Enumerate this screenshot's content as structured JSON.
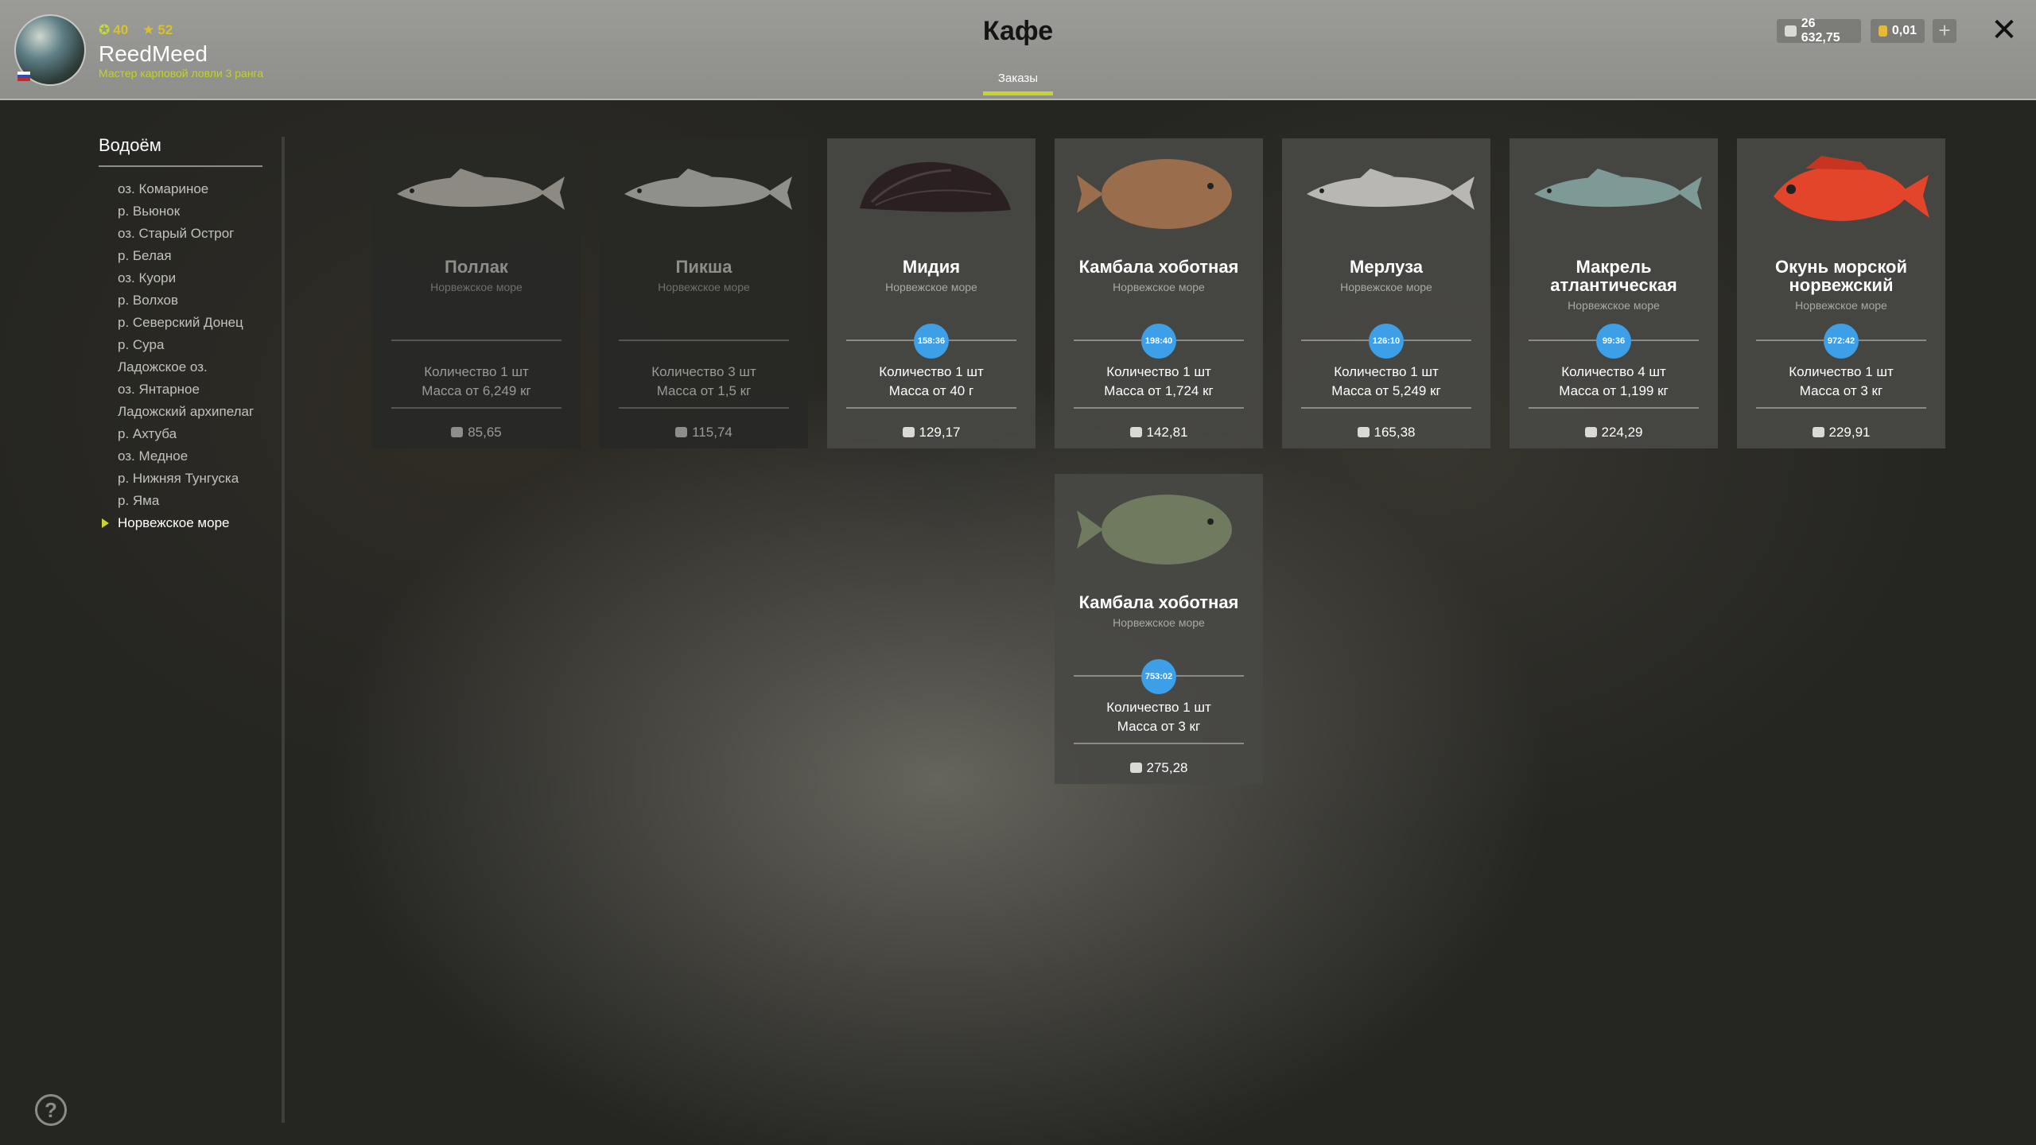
{
  "player": {
    "level": "40",
    "stars": "52",
    "name": "ReedMeed",
    "rank": "Мастер карповой ловли 3 ранга"
  },
  "header": {
    "title": "Кафе",
    "tab": "Заказы",
    "silver": "26 632,75",
    "gold": "0,01",
    "add": "+",
    "close": "✕"
  },
  "sidebar": {
    "title": "Водоём",
    "items": [
      "оз. Комариное",
      "р. Вьюнок",
      "оз. Старый Острог",
      "р. Белая",
      "оз. Куори",
      "р. Волхов",
      "р. Северский Донец",
      "р. Сура",
      "Ладожское оз.",
      "оз. Янтарное",
      "Ладожский архипелаг",
      "р. Ахтуба",
      "оз. Медное",
      "р. Нижняя Тунгуска",
      "р. Яма",
      "Норвежское море"
    ],
    "active_index": 15
  },
  "help": "?",
  "orders": [
    {
      "name": "Поллак",
      "location": "Норвежское море",
      "timer": "",
      "qty": "Количество 1 шт",
      "mass": "Масса от 6,249 кг",
      "price": "85,65",
      "available": false,
      "fish_color": "#8c8a83"
    },
    {
      "name": "Пикша",
      "location": "Норвежское море",
      "timer": "",
      "qty": "Количество 3 шт",
      "mass": "Масса от 1,5 кг",
      "price": "115,74",
      "available": false,
      "fish_color": "#8f8f8b"
    },
    {
      "name": "Мидия",
      "location": "Норвежское море",
      "timer": "158:36",
      "qty": "Количество 1 шт",
      "mass": "Масса от 40 г",
      "price": "129,17",
      "available": true,
      "fish_color": "#2a2022"
    },
    {
      "name": "Камбала хоботная",
      "location": "Норвежское море",
      "timer": "198:40",
      "qty": "Количество 1 шт",
      "mass": "Масса от 1,724 кг",
      "price": "142,81",
      "available": true,
      "fish_color": "#9a6e4c"
    },
    {
      "name": "Мерлуза",
      "location": "Норвежское море",
      "timer": "126:10",
      "qty": "Количество 1 шт",
      "mass": "Масса от 5,249 кг",
      "price": "165,38",
      "available": true,
      "fish_color": "#b9b7b3"
    },
    {
      "name": "Макрель атлантическая",
      "location": "Норвежское море",
      "timer": "99:36",
      "qty": "Количество 4 шт",
      "mass": "Масса от 1,199 кг",
      "price": "224,29",
      "available": true,
      "fish_color": "#7d9a96"
    },
    {
      "name": "Окунь морской норвежский",
      "location": "Норвежское море",
      "timer": "972:42",
      "qty": "Количество 1 шт",
      "mass": "Масса от 3 кг",
      "price": "229,91",
      "available": true,
      "fish_color": "#e2452a"
    },
    {
      "name": "Камбала хоботная",
      "location": "Норвежское море",
      "timer": "753:02",
      "qty": "Количество 1 шт",
      "mass": "Масса от 3 кг",
      "price": "275,28",
      "available": true,
      "fish_color": "#6f7a5f"
    }
  ]
}
